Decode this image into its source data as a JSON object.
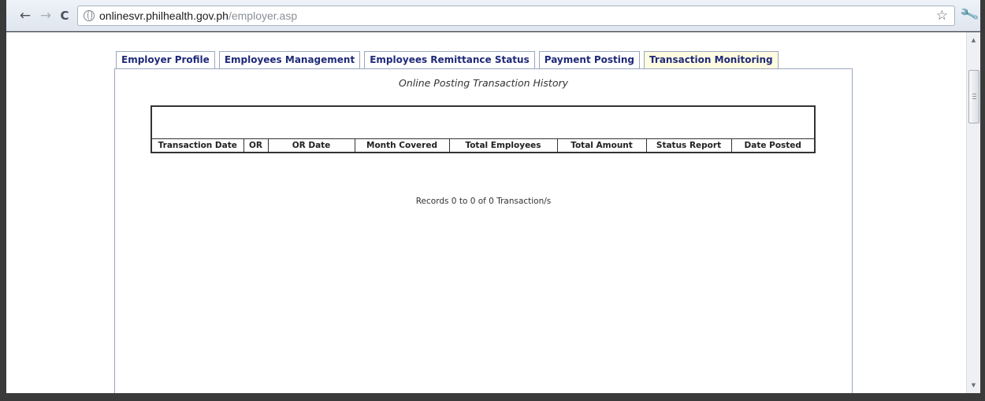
{
  "browser": {
    "url_domain": "onlinesvr.philhealth.gov.ph",
    "url_path": "/employer.asp",
    "back_glyph": "←",
    "forward_glyph": "→",
    "reload_glyph": "C",
    "star_glyph": "☆",
    "wrench_glyph": "🔧",
    "scroll_up_glyph": "▲",
    "scroll_down_glyph": "▼"
  },
  "tabs": [
    {
      "label": "Employer Profile",
      "active": false
    },
    {
      "label": "Employees Management",
      "active": false
    },
    {
      "label": "Employees Remittance Status",
      "active": false
    },
    {
      "label": "Payment Posting",
      "active": false
    },
    {
      "label": "Transaction Monitoring",
      "active": true
    }
  ],
  "panel": {
    "title": "Online Posting Transaction History",
    "table_headers": [
      "Transaction Date",
      "OR",
      "OR Date",
      "Month Covered",
      "Total Employees",
      "Total Amount",
      "Status Report",
      "Date Posted"
    ],
    "records_text": "Records 0 to 0 of 0 Transaction/s"
  },
  "colors": {
    "tab_text": "#1f2a78",
    "active_tab_bg": "#fffbe0",
    "panel_border": "#9aa6bf"
  }
}
